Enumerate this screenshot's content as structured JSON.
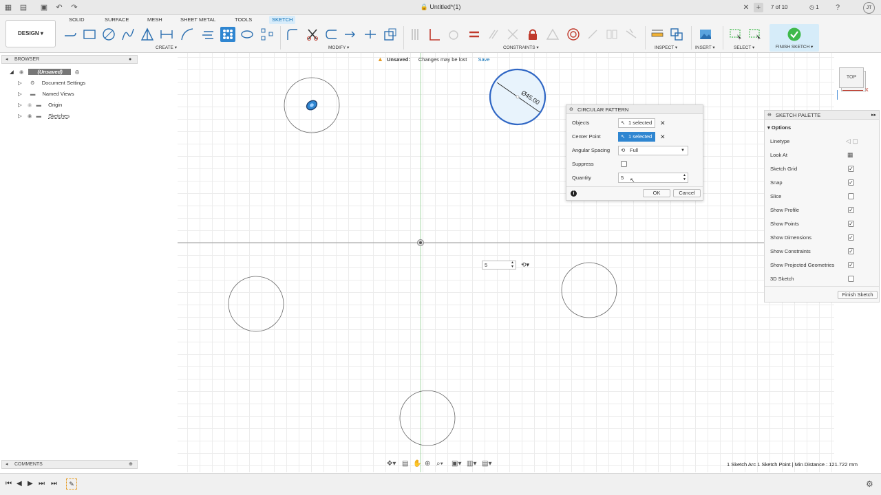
{
  "window": {
    "title": "Untitled*(1)",
    "tab_count": "7 of 10",
    "notifications": "1",
    "user_initials": "JT"
  },
  "toolbar": {
    "workspace": "DESIGN ▾",
    "tabs": [
      "SOLID",
      "SURFACE",
      "MESH",
      "SHEET METAL",
      "TOOLS",
      "SKETCH"
    ],
    "active_tab": "SKETCH",
    "groups": {
      "create": "CREATE ▾",
      "modify": "MODIFY ▾",
      "constraints": "CONSTRAINTS ▾",
      "inspect": "INSPECT ▾",
      "insert": "INSERT ▾",
      "select": "SELECT ▾",
      "finish": "FINISH SKETCH ▾"
    }
  },
  "browser": {
    "title": "BROWSER",
    "items": [
      {
        "label": "(Unsaved)"
      },
      {
        "label": "Document Settings"
      },
      {
        "label": "Named Views"
      },
      {
        "label": "Origin"
      },
      {
        "label": "Sketches"
      }
    ]
  },
  "banner": {
    "label": "Unsaved:",
    "message": "Changes may be lost",
    "action": "Save"
  },
  "dimension": {
    "label": "Ø45.00"
  },
  "dialog": {
    "title": "CIRCULAR PATTERN",
    "objects_label": "Objects",
    "objects_value": "1 selected",
    "center_label": "Center Point",
    "center_value": "1 selected",
    "spacing_label": "Angular Spacing",
    "spacing_value": "Full",
    "suppress_label": "Suppress",
    "quantity_label": "Quantity",
    "quantity_value": "5",
    "ok": "OK",
    "cancel": "Cancel"
  },
  "inline_quantity": "5",
  "palette": {
    "title": "SKETCH PALETTE",
    "section": "Options",
    "rows": [
      {
        "label": "Linetype"
      },
      {
        "label": "Look At"
      },
      {
        "label": "Sketch Grid",
        "checked": true
      },
      {
        "label": "Snap",
        "checked": true
      },
      {
        "label": "Slice",
        "checked": false
      },
      {
        "label": "Show Profile",
        "checked": true
      },
      {
        "label": "Show Points",
        "checked": true
      },
      {
        "label": "Show Dimensions",
        "checked": true
      },
      {
        "label": "Show Constraints",
        "checked": true
      },
      {
        "label": "Show Projected Geometries",
        "checked": true
      },
      {
        "label": "3D Sketch",
        "checked": false
      }
    ],
    "finish_button": "Finish Sketch"
  },
  "viewcube": {
    "face": "TOP",
    "axis_x": "X"
  },
  "comments": {
    "title": "COMMENTS"
  },
  "status": {
    "text": "1 Sketch Arc 1 Sketch Point | Min Distance : 121.722 mm"
  },
  "colors": {
    "accent": "#0a6fb6",
    "selected": "#2f86d1",
    "finish_green": "#3fb94a",
    "constraint_red": "#c0392b"
  }
}
